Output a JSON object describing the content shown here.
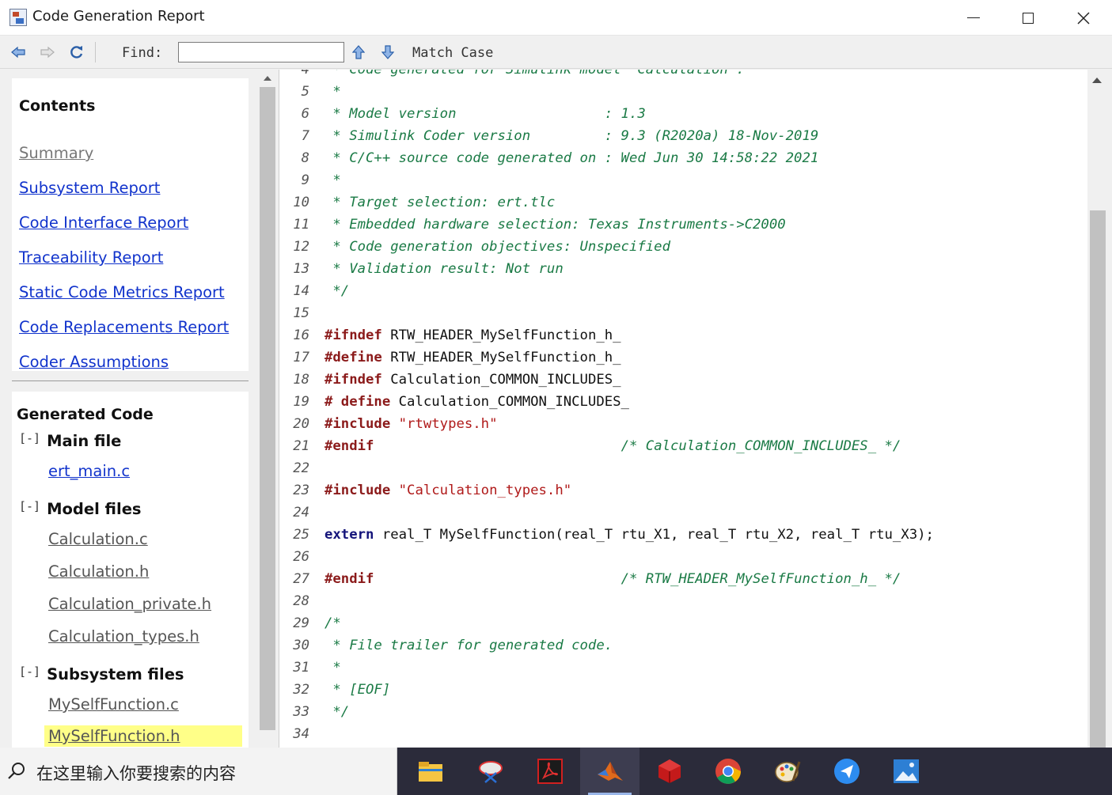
{
  "window": {
    "title": "Code Generation Report"
  },
  "toolbar": {
    "find_label": "Find:",
    "find_value": "",
    "match_case_label": "Match Case"
  },
  "contents": {
    "title": "Contents",
    "links": [
      {
        "label": "Summary",
        "visited": true
      },
      {
        "label": "Subsystem Report",
        "visited": false
      },
      {
        "label": "Code Interface Report",
        "visited": false
      },
      {
        "label": "Traceability Report",
        "visited": false
      },
      {
        "label": "Static Code Metrics Report",
        "visited": false
      },
      {
        "label": "Code Replacements Report",
        "visited": false
      },
      {
        "label": "Coder Assumptions",
        "visited": false
      }
    ]
  },
  "generated_code": {
    "title": "Generated Code",
    "toggle": "[-]",
    "groups": [
      {
        "label": "Main file",
        "files": [
          {
            "name": "ert_main.c",
            "visited": false,
            "selected": false
          }
        ]
      },
      {
        "label": "Model files",
        "files": [
          {
            "name": "Calculation.c",
            "visited": true,
            "selected": false
          },
          {
            "name": "Calculation.h",
            "visited": true,
            "selected": false
          },
          {
            "name": "Calculation_private.h",
            "visited": true,
            "selected": false
          },
          {
            "name": "Calculation_types.h",
            "visited": true,
            "selected": false
          }
        ]
      },
      {
        "label": "Subsystem files",
        "files": [
          {
            "name": "MySelfFunction.c",
            "visited": true,
            "selected": false
          },
          {
            "name": "MySelfFunction.h",
            "visited": true,
            "selected": true
          }
        ]
      }
    ]
  },
  "code": {
    "lines": [
      {
        "n": "4",
        "segs": [
          {
            "t": " * Code generated for Simulink model 'Calculation'.",
            "c": "cmt"
          }
        ]
      },
      {
        "n": "5",
        "segs": [
          {
            "t": " *",
            "c": "cmt"
          }
        ]
      },
      {
        "n": "6",
        "segs": [
          {
            "t": " * Model version                  : 1.3",
            "c": "cmt"
          }
        ]
      },
      {
        "n": "7",
        "segs": [
          {
            "t": " * Simulink Coder version         : 9.3 (R2020a) 18-Nov-2019",
            "c": "cmt"
          }
        ]
      },
      {
        "n": "8",
        "segs": [
          {
            "t": " * C/C++ source code generated on : Wed Jun 30 14:58:22 2021",
            "c": "cmt"
          }
        ]
      },
      {
        "n": "9",
        "segs": [
          {
            "t": " *",
            "c": "cmt"
          }
        ]
      },
      {
        "n": "10",
        "segs": [
          {
            "t": " * Target selection: ert.tlc",
            "c": "cmt"
          }
        ]
      },
      {
        "n": "11",
        "segs": [
          {
            "t": " * Embedded hardware selection: Texas Instruments->C2000",
            "c": "cmt"
          }
        ]
      },
      {
        "n": "12",
        "segs": [
          {
            "t": " * Code generation objectives: Unspecified",
            "c": "cmt"
          }
        ]
      },
      {
        "n": "13",
        "segs": [
          {
            "t": " * Validation result: Not run",
            "c": "cmt"
          }
        ]
      },
      {
        "n": "14",
        "segs": [
          {
            "t": " */",
            "c": "cmt"
          }
        ]
      },
      {
        "n": "15",
        "segs": []
      },
      {
        "n": "16",
        "segs": [
          {
            "t": "#ifndef",
            "c": "kw"
          },
          {
            "t": " RTW_HEADER_MySelfFunction_h_",
            "c": ""
          }
        ]
      },
      {
        "n": "17",
        "segs": [
          {
            "t": "#define",
            "c": "kw"
          },
          {
            "t": " RTW_HEADER_MySelfFunction_h_",
            "c": ""
          }
        ]
      },
      {
        "n": "18",
        "segs": [
          {
            "t": "#ifndef",
            "c": "kw"
          },
          {
            "t": " Calculation_COMMON_INCLUDES_",
            "c": ""
          }
        ]
      },
      {
        "n": "19",
        "segs": [
          {
            "t": "# define",
            "c": "kw"
          },
          {
            "t": " Calculation_COMMON_INCLUDES_",
            "c": ""
          }
        ]
      },
      {
        "n": "20",
        "segs": [
          {
            "t": "#include",
            "c": "kw"
          },
          {
            "t": " ",
            "c": ""
          },
          {
            "t": "\"rtwtypes.h\"",
            "c": "str"
          }
        ]
      },
      {
        "n": "21",
        "segs": [
          {
            "t": "#endif",
            "c": "kw"
          },
          {
            "t": "                              ",
            "c": ""
          },
          {
            "t": "/* Calculation_COMMON_INCLUDES_ */",
            "c": "cmt"
          }
        ]
      },
      {
        "n": "22",
        "segs": []
      },
      {
        "n": "23",
        "segs": [
          {
            "t": "#include",
            "c": "kw"
          },
          {
            "t": " ",
            "c": ""
          },
          {
            "t": "\"Calculation_types.h\"",
            "c": "str"
          }
        ]
      },
      {
        "n": "24",
        "segs": []
      },
      {
        "n": "25",
        "segs": [
          {
            "t": "extern",
            "c": "kw2"
          },
          {
            "t": " real_T MySelfFunction(real_T rtu_X1, real_T rtu_X2, real_T rtu_X3);",
            "c": ""
          }
        ]
      },
      {
        "n": "26",
        "segs": []
      },
      {
        "n": "27",
        "segs": [
          {
            "t": "#endif",
            "c": "kw"
          },
          {
            "t": "                              ",
            "c": ""
          },
          {
            "t": "/* RTW_HEADER_MySelfFunction_h_ */",
            "c": "cmt"
          }
        ]
      },
      {
        "n": "28",
        "segs": []
      },
      {
        "n": "29",
        "segs": [
          {
            "t": "/*",
            "c": "cmt"
          }
        ]
      },
      {
        "n": "30",
        "segs": [
          {
            "t": " * File trailer for generated code.",
            "c": "cmt"
          }
        ]
      },
      {
        "n": "31",
        "segs": [
          {
            "t": " *",
            "c": "cmt"
          }
        ]
      },
      {
        "n": "32",
        "segs": [
          {
            "t": " * [EOF]",
            "c": "cmt"
          }
        ]
      },
      {
        "n": "33",
        "segs": [
          {
            "t": " */",
            "c": "cmt"
          }
        ]
      },
      {
        "n": "34",
        "segs": []
      }
    ]
  },
  "taskbar": {
    "search_placeholder": "在这里输入你要搜索的内容",
    "apps": [
      "file-explorer-icon",
      "snipping-tool-icon",
      "pdf-reader-icon",
      "matlab-icon",
      "3d-app-icon",
      "chrome-icon",
      "paint-icon",
      "messenger-icon",
      "photos-icon"
    ],
    "active_app": "matlab-icon"
  },
  "colors": {
    "link": "#1133cc",
    "visited_link": "#555555",
    "comment": "#1a7a45",
    "preprocessor": "#8b1a1a",
    "string": "#b01a1a",
    "highlight": "#ffff88"
  }
}
